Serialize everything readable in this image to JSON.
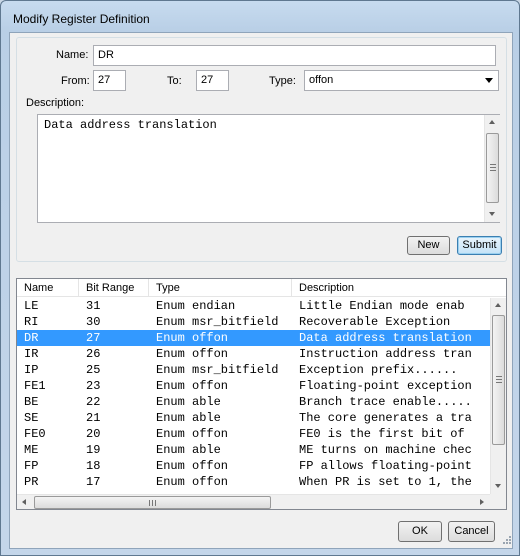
{
  "window": {
    "title": "Modify Register Definition"
  },
  "form": {
    "name_label": "Name:",
    "name_value": "DR",
    "from_label": "From:",
    "from_value": "27",
    "to_label": "To:",
    "to_value": "27",
    "type_label": "Type:",
    "type_value": "offon",
    "description_label": "Description:",
    "description_value": "Data address translation"
  },
  "buttons": {
    "new": "New",
    "submit": "Submit",
    "ok": "OK",
    "cancel": "Cancel"
  },
  "table": {
    "columns": [
      "Name",
      "Bit Range",
      "Type",
      "Description"
    ],
    "selected_index": 2,
    "rows": [
      {
        "name": "LE",
        "bits": "31",
        "type": "Enum endian",
        "desc": "Little Endian mode enab"
      },
      {
        "name": "RI",
        "bits": "30",
        "type": "Enum msr_bitfield",
        "desc": "Recoverable Exception"
      },
      {
        "name": "DR",
        "bits": "27",
        "type": "Enum offon",
        "desc": "Data address translation"
      },
      {
        "name": "IR",
        "bits": "26",
        "type": "Enum offon",
        "desc": "Instruction address tran"
      },
      {
        "name": "IP",
        "bits": "25",
        "type": "Enum msr_bitfield",
        "desc": "Exception prefix......"
      },
      {
        "name": "FE1",
        "bits": "23",
        "type": "Enum offon",
        "desc": "Floating-point exception"
      },
      {
        "name": "BE",
        "bits": "22",
        "type": "Enum able",
        "desc": "Branch trace enable....."
      },
      {
        "name": "SE",
        "bits": "21",
        "type": "Enum able",
        "desc": "The core generates a tra"
      },
      {
        "name": "FE0",
        "bits": "20",
        "type": "Enum offon",
        "desc": "FE0 is the first bit of"
      },
      {
        "name": "ME",
        "bits": "19",
        "type": "Enum able",
        "desc": "ME turns on machine chec"
      },
      {
        "name": "FP",
        "bits": "18",
        "type": "Enum offon",
        "desc": "FP allows floating-point"
      },
      {
        "name": "PR",
        "bits": "17",
        "type": "Enum offon",
        "desc": "When PR is set to 1, the"
      }
    ]
  }
}
